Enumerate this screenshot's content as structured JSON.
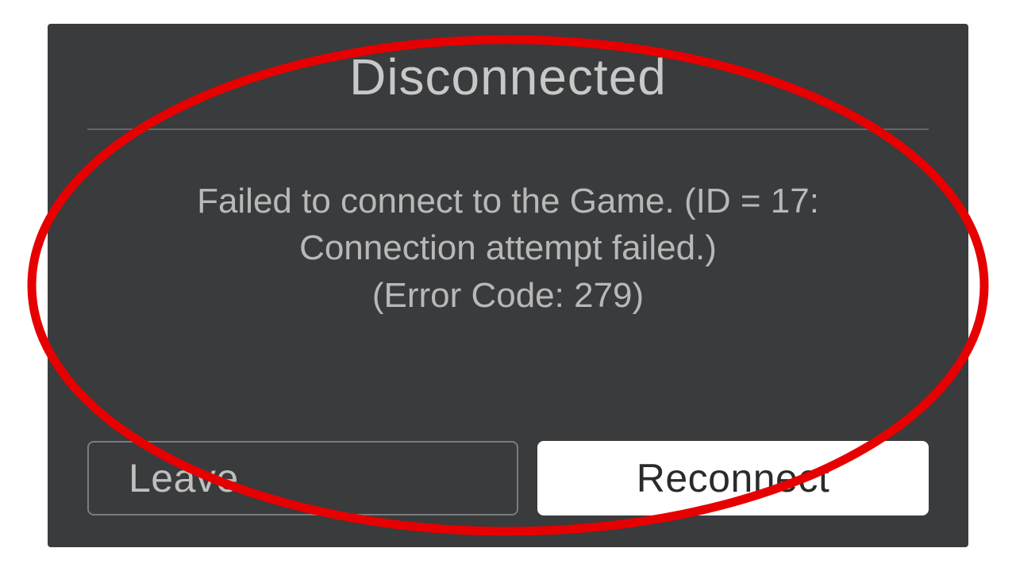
{
  "dialog": {
    "title": "Disconnected",
    "message": "Failed to connect to the Game. (ID = 17: Connection attempt failed.) (Error Code: 279)",
    "message_line1": "Failed to connect to the Game. (ID = 17:",
    "message_line2": "Connection attempt failed.)",
    "message_line3": "(Error Code: 279)",
    "leave_label": "Leave",
    "reconnect_label": "Reconnect"
  },
  "colors": {
    "dialog_bg": "#393b3d",
    "text_light": "#c8c8c8",
    "divider": "#646668",
    "annotation_red": "#e60000"
  }
}
